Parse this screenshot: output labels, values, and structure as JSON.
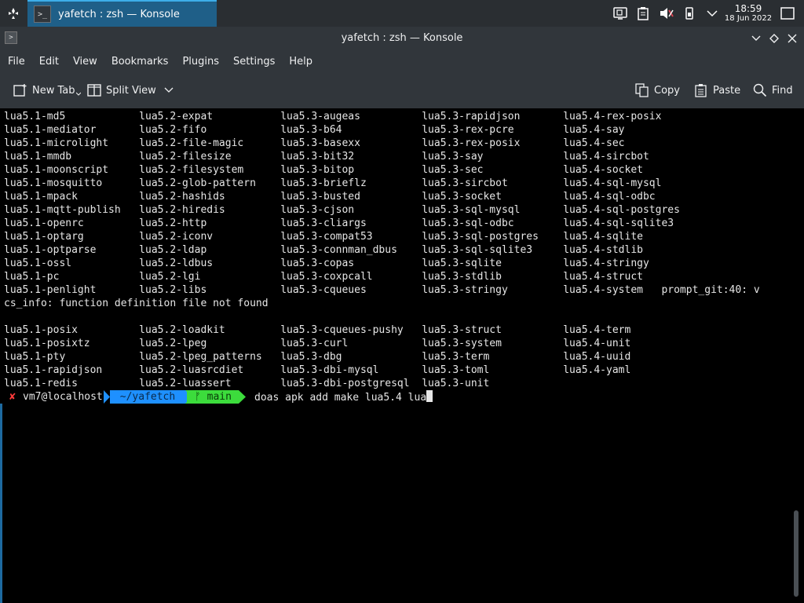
{
  "taskbar": {
    "launcher_icon": "kde-launcher-icon",
    "task_title": "yafetch : zsh — Konsole",
    "tray_icons": [
      "network-monitor-icon",
      "clipboard-icon",
      "volume-muted-icon",
      "device-icon",
      "chevron-down-icon"
    ],
    "clock": {
      "time": "18:59",
      "date": "18 Jun 2022"
    },
    "show_desktop_icon": "show-desktop-icon"
  },
  "window": {
    "title": "yafetch : zsh — Konsole",
    "buttons": [
      "minimize",
      "keep-above",
      "close"
    ]
  },
  "menubar": {
    "items": [
      "File",
      "Edit",
      "View",
      "Bookmarks",
      "Plugins",
      "Settings",
      "Help"
    ]
  },
  "toolbar": {
    "new_tab": "New Tab",
    "split_view": "Split View",
    "copy": "Copy",
    "paste": "Paste",
    "find": "Find"
  },
  "terminal": {
    "output": "lua5.1-md5            lua5.2-expat           lua5.3-augeas          lua5.3-rapidjson       lua5.4-rex-posix\nlua5.1-mediator       lua5.2-fifo            lua5.3-b64             lua5.3-rex-pcre        lua5.4-say\nlua5.1-microlight     lua5.2-file-magic      lua5.3-basexx          lua5.3-rex-posix       lua5.4-sec\nlua5.1-mmdb           lua5.2-filesize        lua5.3-bit32           lua5.3-say             lua5.4-sircbot\nlua5.1-moonscript     lua5.2-filesystem      lua5.3-bitop           lua5.3-sec             lua5.4-socket\nlua5.1-mosquitto      lua5.2-glob-pattern    lua5.3-brieflz         lua5.3-sircbot         lua5.4-sql-mysql\nlua5.1-mpack          lua5.2-hashids         lua5.3-busted          lua5.3-socket          lua5.4-sql-odbc\nlua5.1-mqtt-publish   lua5.2-hiredis         lua5.3-cjson           lua5.3-sql-mysql       lua5.4-sql-postgres\nlua5.1-openrc         lua5.2-http            lua5.3-cliargs         lua5.3-sql-odbc        lua5.4-sql-sqlite3\nlua5.1-optarg         lua5.2-iconv           lua5.3-compat53        lua5.3-sql-postgres    lua5.4-sqlite\nlua5.1-optparse       lua5.2-ldap            lua5.3-connman_dbus    lua5.3-sql-sqlite3     lua5.4-stdlib\nlua5.1-ossl           lua5.2-ldbus           lua5.3-copas           lua5.3-sqlite          lua5.4-stringy\nlua5.1-pc             lua5.2-lgi             lua5.3-coxpcall        lua5.3-stdlib          lua5.4-struct\nlua5.1-penlight       lua5.2-libs            lua5.3-cqueues         lua5.3-stringy         lua5.4-system   prompt_git:40: v\ncs_info: function definition file not found\n\nlua5.1-posix          lua5.2-loadkit         lua5.3-cqueues-pushy   lua5.3-struct          lua5.4-term\nlua5.1-posixtz        lua5.2-lpeg            lua5.3-curl            lua5.3-system          lua5.4-unit\nlua5.1-pty            lua5.2-lpeg_patterns   lua5.3-dbg             lua5.3-term            lua5.4-uuid\nlua5.1-rapidjson      lua5.2-luasrcdiet      lua5.3-dbi-mysql       lua5.3-toml            lua5.4-yaml\nlua5.1-redis          lua5.2-luassert        lua5.3-dbi-postgresql  lua5.3-unit",
    "prompt": {
      "status_symbol": "✘",
      "user_host": "vm7@localhost",
      "directory": "~/yafetch",
      "git_branch": "ᚠ main",
      "command": "doas apk add make lua5.4 lua"
    }
  }
}
